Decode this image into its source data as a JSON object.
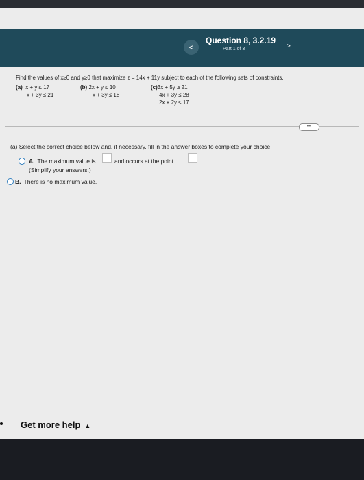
{
  "header": {
    "question_title": "Question 8, 3.2.19",
    "part": "Part 1 of 3",
    "prev_icon": "<",
    "next_icon": ">"
  },
  "problem": {
    "prompt": "Find the values of x≥0 and y≥0 that maximize z = 14x + 11y subject to each of the following sets of constraints.",
    "sets": [
      {
        "label": "(a)",
        "lines": [
          "x +  y ≤ 17",
          "x + 3y ≤ 21"
        ]
      },
      {
        "label": "(b)",
        "lines": [
          "2x +  y ≤ 10",
          "x + 3y ≤ 18"
        ]
      },
      {
        "label": "(c)",
        "lines": [
          "3x + 5y ≥ 21",
          "4x + 3y ≤ 28",
          "2x + 2y ≤ 17"
        ]
      }
    ]
  },
  "more_button": "•••",
  "part_a": {
    "instruction": "(a) Select the correct choice below and, if necessary, fill in the answer boxes to complete your choice.",
    "choice_a": {
      "letter": "A.",
      "text_before": "The maximum value is",
      "text_middle": "and occurs at the point",
      "text_end": ".",
      "note": "(Simplify your answers.)"
    },
    "choice_b": {
      "letter": "B.",
      "text": "There is no maximum value."
    }
  },
  "footer": {
    "help_label": "Get more help",
    "help_caret": "▲"
  }
}
